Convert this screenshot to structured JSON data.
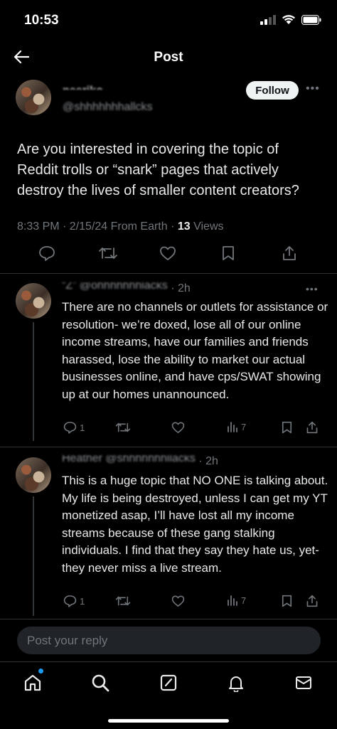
{
  "status_bar": {
    "time": "10:53"
  },
  "nav": {
    "title": "Post"
  },
  "post": {
    "author_name_blurred": "neeriko",
    "author_handle_blurred": "@shhhhhhhallcks",
    "follow_label": "Follow",
    "text": "Are you interested in covering the topic of Reddit trolls or “snark” pages that actively destroy the lives of smaller content creators?",
    "timestamp": "8:33 PM · 2/15/24 From Earth · ",
    "views_count": "13",
    "views_label": " Views"
  },
  "replies": [
    {
      "name_blurred": "“Z” @ohhhhhhhlacks",
      "time": "· 2h",
      "text": "There are no channels or outlets for assistance or resolution- we’re doxed, lose all of our online income streams, have our families and friends harassed, lose the ability to market our actual businesses online, and have cps/SWAT showing up at our homes unannounced.",
      "reply_count": "1",
      "view_count": "7"
    },
    {
      "name_blurred": "Heather @shhhhhhhllacks",
      "time": "· 2h",
      "text": "This is a huge topic that NO ONE is talking about.\nMy life is being destroyed, unless I can get my YT monetized asap, I’ll have lost all my income streams because of these gang stalking individuals. I find that they say they hate us, yet- they never miss a live stream.",
      "reply_count": "1",
      "view_count": "7"
    }
  ],
  "reply_box": {
    "placeholder": "Post your reply"
  },
  "colors": {
    "background": "#000000",
    "text": "#e7e9ea",
    "muted": "#71767b",
    "accent": "#1d9bf0",
    "divider": "#2f3336"
  },
  "icons": [
    "back-arrow-icon",
    "reply-icon",
    "retweet-icon",
    "like-icon",
    "bookmark-icon",
    "share-icon",
    "views-icon",
    "home-icon",
    "search-icon",
    "compose-icon",
    "notifications-icon",
    "messages-icon"
  ]
}
